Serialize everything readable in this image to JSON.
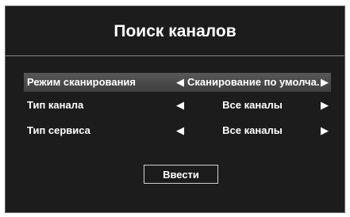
{
  "dialog": {
    "title": "Поиск каналов"
  },
  "settings": [
    {
      "label": "Режим сканирования",
      "value": "Сканирование по умолча...",
      "selected": true
    },
    {
      "label": "Тип канала",
      "value": "Все каналы",
      "selected": false
    },
    {
      "label": "Тип сервиса",
      "value": "Все каналы",
      "selected": false
    }
  ],
  "icons": {
    "left": "arrow-left-icon",
    "right": "arrow-right-icon"
  },
  "buttons": {
    "enter_label": "Ввести"
  }
}
